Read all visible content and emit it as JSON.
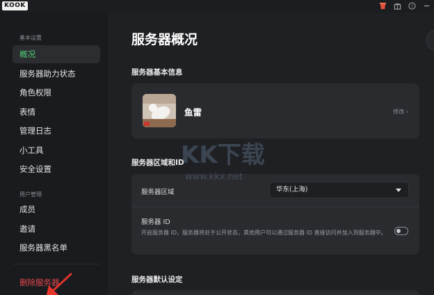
{
  "app": {
    "logo": "KOOK"
  },
  "titlebar_icons": [
    "cup-icon",
    "gift-icon",
    "help-icon",
    "minimize-icon"
  ],
  "sidebar": {
    "sections": [
      {
        "title": "基本设置",
        "items": [
          "概况",
          "服务器助力状态",
          "角色权限",
          "表情",
          "管理日志",
          "小工具",
          "安全设置"
        ]
      },
      {
        "title": "用户管理",
        "items": [
          "成员",
          "邀请",
          "服务器黑名单"
        ]
      }
    ],
    "active_item": "概况",
    "danger_item": "删除服务器"
  },
  "main": {
    "title": "服务器概况",
    "basic_info": {
      "label": "服务器基本信息",
      "server_name": "鱼雷",
      "edit_label": "修改 ›"
    },
    "region_id": {
      "label": "服务器区域和ID",
      "region_label": "服务器区域",
      "region_value": "华东(上海)",
      "id_label": "服务器 ID",
      "id_description": "开启服务器 ID，服务器将处于公开状态，其他用户可以通过服务器 ID 直接访问并加入到服务器中。",
      "id_toggle_on": false
    },
    "defaults": {
      "label": "服务器默认设定"
    }
  },
  "watermark": {
    "text1": "KK下载",
    "text2": "www.kkx.net"
  },
  "colors": {
    "accent": "#4fd07a",
    "danger": "#e2474b",
    "arrow": "#e8352c",
    "background": "#1f2023",
    "card": "#2a2b2f"
  }
}
